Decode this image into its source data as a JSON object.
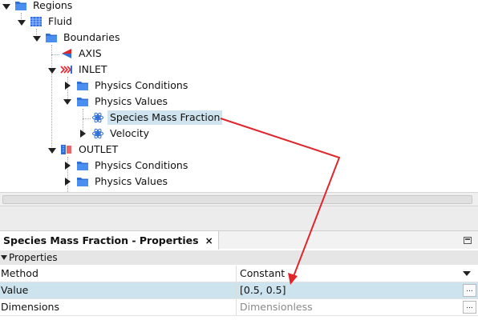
{
  "tree": {
    "regions": "Regions",
    "fluid": "Fluid",
    "boundaries": "Boundaries",
    "axis": "AXIS",
    "inlet": "INLET",
    "inlet_physics_conditions": "Physics Conditions",
    "inlet_physics_values": "Physics Values",
    "species_mass_fraction": "Species Mass Fraction",
    "velocity": "Velocity",
    "outlet": "OUTLET",
    "outlet_physics_conditions": "Physics Conditions",
    "outlet_physics_values": "Physics Values"
  },
  "properties_panel": {
    "tab_title": "Species Mass Fraction - Properties",
    "tab_close": "×",
    "section": "Properties",
    "rows": [
      {
        "key": "Method",
        "value": "Constant"
      },
      {
        "key": "Value",
        "value": "[0.5, 0.5]",
        "button": "..."
      },
      {
        "key": "Dimensions",
        "value": "Dimensionless",
        "button": "..."
      }
    ]
  },
  "colors": {
    "selection": "#cfe4ef",
    "annotation_arrow": "#e0262b",
    "folder_icon": "#2f6fd6"
  }
}
